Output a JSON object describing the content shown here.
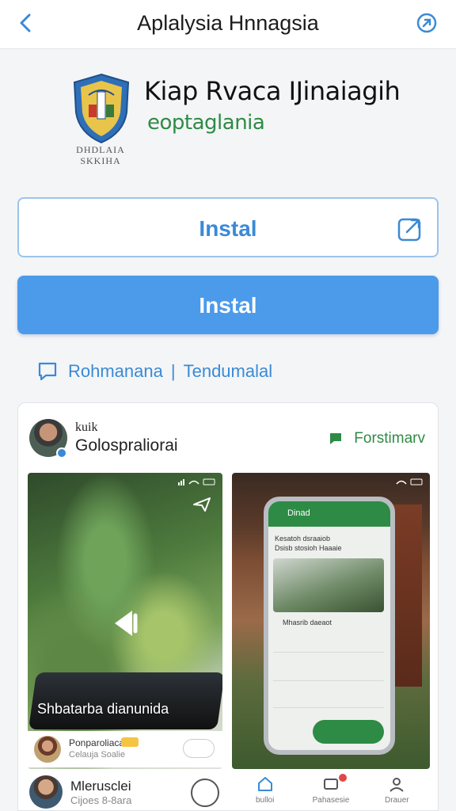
{
  "topbar": {
    "title": "Aplalysia Hnnagsia",
    "back_icon": "back-arrow-icon",
    "share_icon": "share-icon"
  },
  "app": {
    "name": "Kiap Rvaca IJinaiagih",
    "developer": "eoptaglania",
    "crest_text_line1": "DHDLAIA",
    "crest_text_line2": "SKKIHA"
  },
  "buttons": {
    "outline_label": "Instal",
    "primary_label": "Instal"
  },
  "links": {
    "left": "Rohmanana",
    "separator": "|",
    "right": "Tendumalal"
  },
  "review_card": {
    "author_top": "kuik",
    "author_name": "Golospraliorai",
    "follow_label": "Forstimarv",
    "screenshot1": {
      "caption": "Shbatarba dianunida",
      "user_name": "Ponparoliaca",
      "user_sub": "Celauja Soalie"
    },
    "screenshot2": {
      "mock_title": "Dinad",
      "line1": "Kesatoh dsraaiob",
      "line2": "Dsisb stosioh Haaaie",
      "reply": "Mhasrib daeaot"
    },
    "bottom_user": {
      "name": "Mlerusclei",
      "sub": "Cijoes 8-8ara"
    },
    "nav": [
      {
        "label": "bulloi",
        "icon": "home-icon"
      },
      {
        "label": "Pahasesie",
        "icon": "cart-icon"
      },
      {
        "label": "Drauer",
        "icon": "profile-icon"
      }
    ]
  },
  "colors": {
    "accent": "#4c9aea",
    "brand_green": "#2e8b45",
    "link_blue": "#3a8ad6"
  }
}
